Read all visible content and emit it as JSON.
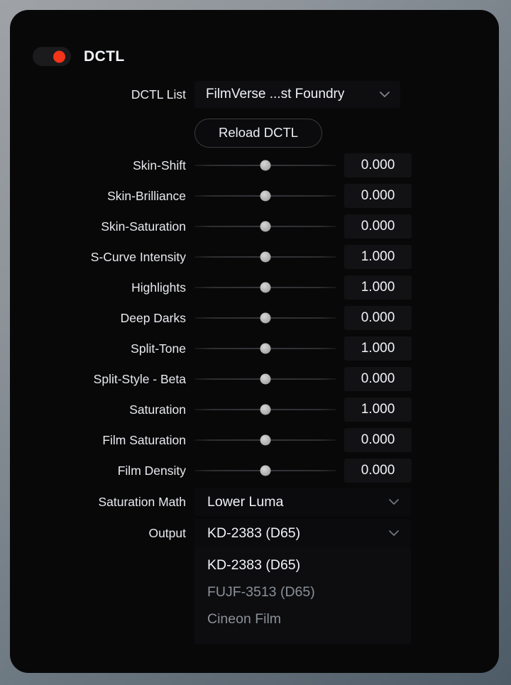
{
  "header": {
    "title": "DCTL",
    "toggle_state": "on",
    "toggle_color": "#f5341a"
  },
  "dctl_list": {
    "label": "DCTL List",
    "value": "FilmVerse ...st Foundry"
  },
  "reload": {
    "label": "Reload DCTL"
  },
  "sliders": [
    {
      "label": "Skin-Shift",
      "value": "0.000"
    },
    {
      "label": "Skin-Brilliance",
      "value": "0.000"
    },
    {
      "label": "Skin-Saturation",
      "value": "0.000"
    },
    {
      "label": "S-Curve Intensity",
      "value": "1.000"
    },
    {
      "label": "Highlights",
      "value": "1.000"
    },
    {
      "label": "Deep Darks",
      "value": "0.000"
    },
    {
      "label": "Split-Tone",
      "value": "1.000"
    },
    {
      "label": "Split-Style - Beta",
      "value": "0.000"
    },
    {
      "label": "Saturation",
      "value": "1.000"
    },
    {
      "label": "Film Saturation",
      "value": "0.000"
    },
    {
      "label": "Film Density",
      "value": "0.000"
    }
  ],
  "saturation_math": {
    "label": "Saturation Math",
    "value": "Lower Luma"
  },
  "output": {
    "label": "Output",
    "value": "KD-2383 (D65)",
    "options": [
      {
        "label": "KD-2383 (D65)",
        "selected": true
      },
      {
        "label": "FUJF-3513 (D65)",
        "selected": false
      },
      {
        "label": "Cineon Film",
        "selected": false
      }
    ]
  }
}
